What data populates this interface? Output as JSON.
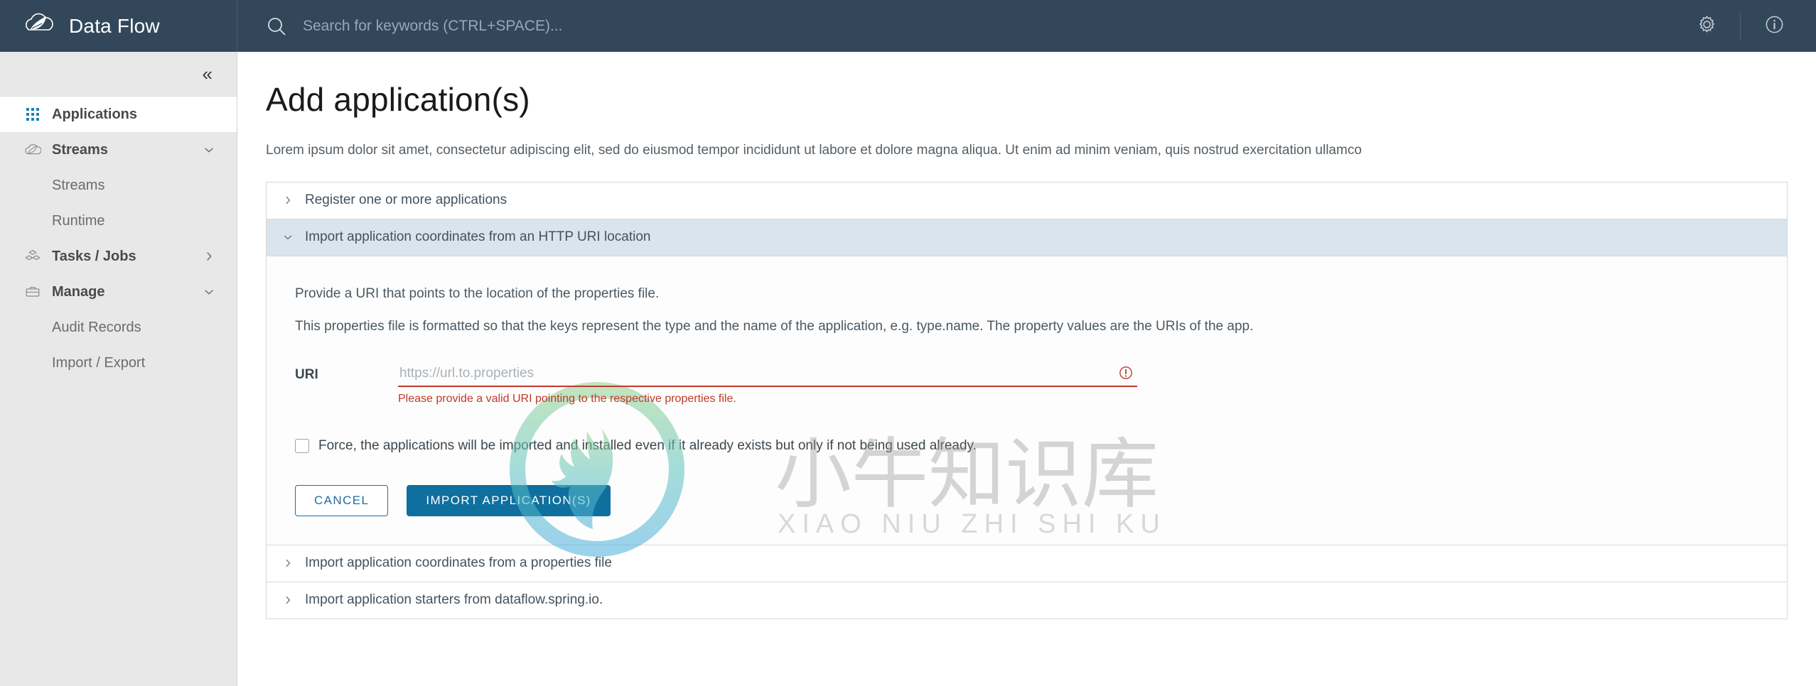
{
  "header": {
    "brand_title": "Data Flow",
    "logo_icon": "dataflow-cloud-logo",
    "search": {
      "placeholder": "Search for keywords (CTRL+SPACE)...",
      "value": "",
      "icon": "search-icon"
    },
    "settings_icon": "gear-icon",
    "about_icon": "info-circle-icon"
  },
  "sidebar": {
    "collapse_icon": "double-chevron-left-icon",
    "items": [
      {
        "label": "Applications",
        "icon": "grid-icon",
        "active": true,
        "expandable": false
      },
      {
        "label": "Streams",
        "icon": "cloud-icon",
        "active": false,
        "expandable": true,
        "chevron": "chevron-down-icon"
      },
      {
        "label": "Streams",
        "sub": true
      },
      {
        "label": "Runtime",
        "sub": true
      },
      {
        "label": "Tasks / Jobs",
        "icon": "tasks-icon",
        "active": false,
        "expandable": true,
        "chevron": "chevron-right-icon"
      },
      {
        "label": "Manage",
        "icon": "briefcase-icon",
        "active": false,
        "expandable": true,
        "chevron": "chevron-down-icon"
      },
      {
        "label": "Audit Records",
        "sub": true
      },
      {
        "label": "Import / Export",
        "sub": true
      }
    ]
  },
  "main": {
    "title": "Add application(s)",
    "description": "Lorem ipsum dolor sit amet, consectetur adipiscing elit, sed do eiusmod tempor incididunt ut labore et dolore magna aliqua. Ut enim ad minim veniam, quis nostrud exercitation ullamco",
    "panels": {
      "register": {
        "title": "Register one or more applications",
        "open": false,
        "chevron": "chevron-right-icon"
      },
      "http_uri": {
        "title": "Import application coordinates from an HTTP URI location",
        "open": true,
        "chevron": "chevron-down-icon"
      },
      "properties_file": {
        "title": "Import application coordinates from a properties file",
        "open": false,
        "chevron": "chevron-right-icon"
      },
      "starters": {
        "title": "Import application starters from dataflow.spring.io.",
        "open": false,
        "chevron": "chevron-right-icon"
      }
    },
    "form": {
      "line1": "Provide a URI that points to the location of the properties file.",
      "line2": "This properties file is formatted so that the keys represent the type and the name of the application, e.g. type.name. The property values are the URIs of the app.",
      "uri_label": "URI",
      "uri_placeholder": "https://url.to.properties",
      "uri_value": "",
      "uri_error": "Please provide a valid URI pointing to the respective properties file.",
      "error_icon": "error-exclamation-circle-icon",
      "force_label": "Force, the applications will be imported and installed even if it already exists but only if not being used already.",
      "force_checked": false,
      "cancel_label": "CANCEL",
      "submit_label": "IMPORT APPLICATION(S)"
    }
  },
  "watermark": {
    "chinese": "小牛知识库",
    "pinyin": "XIAO NIU ZHI SHI KU",
    "logo_icon": "deer-circle-watermark-logo"
  },
  "colors": {
    "topbar": "#33475b",
    "sidebar": "#e8e8e8",
    "accent": "#0f6f9e",
    "error": "#c0392b",
    "panel_open": "#d9e4ec"
  }
}
